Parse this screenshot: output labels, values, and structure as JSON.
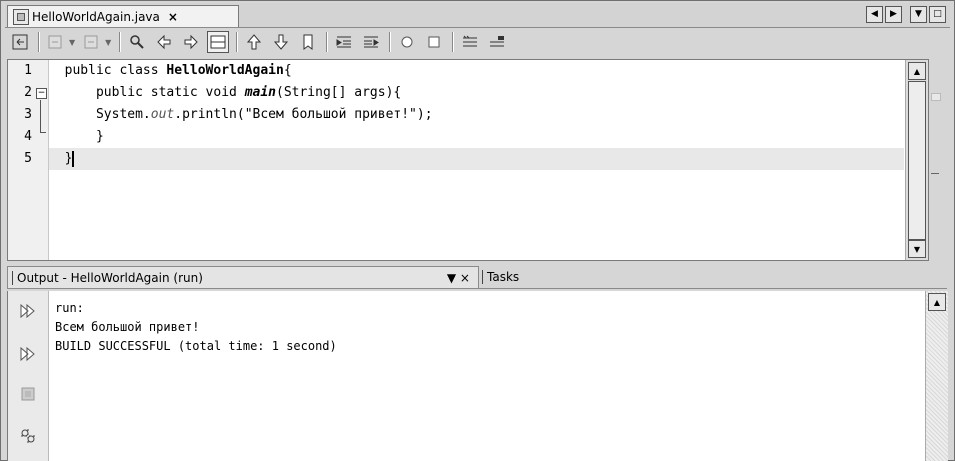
{
  "editor_tab": {
    "filename": "HelloWorldAgain.java",
    "close": "×"
  },
  "window_buttons": [
    "◀",
    "▶",
    "▼",
    "□"
  ],
  "toolbar_icons": [
    "back-to-source-icon",
    "history-back-icon",
    "history-forward-icon",
    "find-selection-icon",
    "find-previous-icon",
    "find-next-icon",
    "toggle-highlight-icon",
    "previous-bookmark-icon",
    "next-bookmark-icon",
    "toggle-bookmark-icon",
    "shift-left-icon",
    "shift-right-icon",
    "start-macro-icon",
    "stop-macro-icon",
    "comment-icon",
    "uncomment-icon"
  ],
  "editor": {
    "line_numbers": [
      "1",
      "2",
      "3",
      "4",
      "5"
    ],
    "lines": [
      {
        "indent": "  ",
        "p1": "public class ",
        "bold": "HelloWorldAgain",
        "p2": "{"
      },
      {
        "indent": "      ",
        "p1": "public static void ",
        "bold": "main",
        "p2": "(String[] args){"
      },
      {
        "indent": "      ",
        "p1": "System.",
        "italic": "out",
        "p2": ".println(\"Всем большой привет!\");"
      },
      {
        "indent": "      ",
        "p1": "}"
      },
      {
        "indent": "  ",
        "p1": "}"
      }
    ]
  },
  "output_window": {
    "tab_label": "Output - HelloWorldAgain (run)",
    "tab_controls": "▼ ×",
    "tasks_label": "Tasks",
    "lines": [
      "run:",
      "Всем большой привет!",
      "BUILD SUCCESSFUL (total time: 1 second)"
    ]
  }
}
